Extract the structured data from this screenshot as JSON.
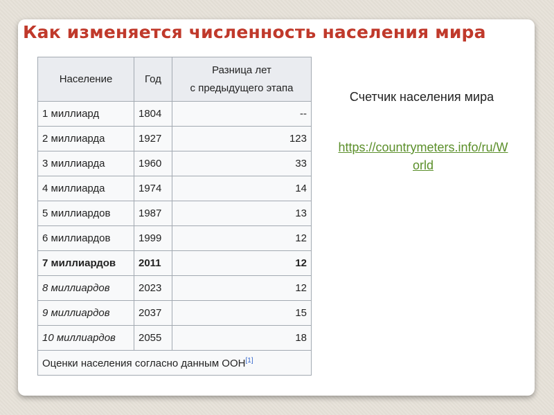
{
  "title": "Как изменяется численность населения мира",
  "table": {
    "headers": [
      "Население",
      "Год",
      "Разница лет с предыдущего этапа"
    ],
    "header_lines": [
      "Разница лет",
      "с предыдущего этапа"
    ],
    "rows": [
      {
        "population": "1 миллиард",
        "year": "1804",
        "diff": "--",
        "style": "normal"
      },
      {
        "population": "2 миллиарда",
        "year": "1927",
        "diff": "123",
        "style": "normal"
      },
      {
        "population": "3 миллиарда",
        "year": "1960",
        "diff": "33",
        "style": "normal"
      },
      {
        "population": "4 миллиарда",
        "year": "1974",
        "diff": "14",
        "style": "normal"
      },
      {
        "population": "5 миллиардов",
        "year": "1987",
        "diff": "13",
        "style": "normal"
      },
      {
        "population": "6 миллиардов",
        "year": "1999",
        "diff": "12",
        "style": "normal"
      },
      {
        "population": "7 миллиардов",
        "year": "2011",
        "diff": "12",
        "style": "bold"
      },
      {
        "population": "8 миллиардов",
        "year": "2023",
        "diff": "12",
        "style": "italic"
      },
      {
        "population": "9 миллиардов",
        "year": "2037",
        "diff": "15",
        "style": "italic"
      },
      {
        "population": "10 миллиардов",
        "year": "2055",
        "diff": "18",
        "style": "italic"
      }
    ],
    "footer": "Оценки населения согласно данным ООН",
    "footer_ref": "[1]"
  },
  "counter": {
    "label": "Счетчик населения мира",
    "link": "https://countrymeters.info/ru/World"
  },
  "colors": {
    "title": "#c0392b",
    "link": "#5b8f2a",
    "table_header_bg": "#eaecf0",
    "table_cell_bg": "#f8f9fa",
    "table_border": "#a2a9b1"
  }
}
